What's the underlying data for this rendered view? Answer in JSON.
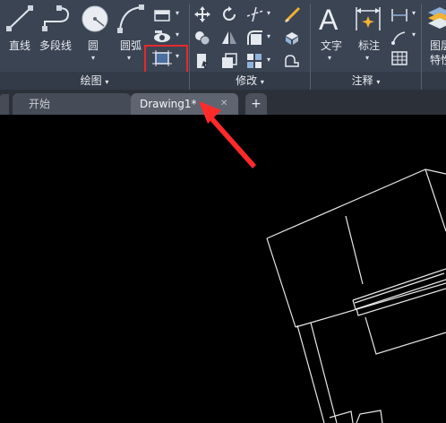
{
  "ribbon": {
    "draw_panel": {
      "footer": "绘图",
      "tools": [
        {
          "label": "直线",
          "icon": "line-icon"
        },
        {
          "label": "多段线",
          "icon": "polyline-icon"
        },
        {
          "label": "圆",
          "icon": "circle-icon"
        },
        {
          "label": "圆弧",
          "icon": "arc-icon"
        }
      ],
      "small_tools": [
        "rectangle-icon",
        "hatch-eye-icon",
        "region-icon"
      ]
    },
    "modify_panel": {
      "footer": "修改",
      "tools": [
        "move-icon",
        "rotate-icon",
        "trim-icon",
        "erase-icon",
        "copy-icon",
        "mirror-icon",
        "fillet-icon",
        "explode-icon",
        "stretch-icon",
        "scale-icon",
        "array-icon",
        "offset-icon"
      ]
    },
    "annotation_panel": {
      "footer": "注释",
      "tools": [
        {
          "label": "文字",
          "icon": "text-icon"
        },
        {
          "label": "标注",
          "icon": "dimension-icon"
        }
      ],
      "small_tools": [
        "linear-dim-icon",
        "leader-icon",
        "table-icon"
      ]
    },
    "layers_panel": {
      "label_line1": "图层",
      "label_line2": "特性"
    }
  },
  "tabs": {
    "start": "开始",
    "drawing": "Drawing1*",
    "close_symbol": "✕",
    "add_symbol": "+"
  },
  "colors": {
    "ribbon_bg": "#3b4453",
    "highlight_box": "#e8282d",
    "arrow": "#ff2a2a",
    "canvas": "#000000"
  }
}
